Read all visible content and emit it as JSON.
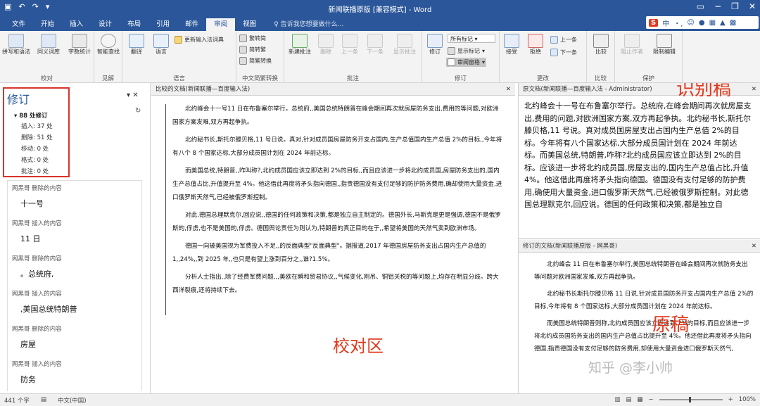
{
  "window": {
    "title": "新闻联播原版 [兼容模式] - Word"
  },
  "tabs": [
    "文件",
    "开始",
    "插入",
    "设计",
    "布局",
    "引用",
    "邮件",
    "审阅",
    "视图"
  ],
  "active_tab": "审阅",
  "tellme": "告诉我您想要做什么...",
  "ime": {
    "label": "中"
  },
  "ribbon": {
    "proofing": {
      "label": "校对",
      "buttons": [
        "拼写和语法",
        "同义词库",
        "字数统计"
      ]
    },
    "insights": {
      "label": "见解",
      "buttons": [
        "智能查找"
      ]
    },
    "language": {
      "label": "语言",
      "buttons": [
        "翻译",
        "语言"
      ],
      "extra": "更新输入法词典"
    },
    "chinese": {
      "label": "中文简繁转换",
      "buttons": [
        "繁转简",
        "简转繁",
        "简繁转换"
      ]
    },
    "comments": {
      "label": "批注",
      "buttons": [
        "新建批注",
        "删除",
        "上一条",
        "下一条",
        "显示批注"
      ]
    },
    "tracking": {
      "label": "修订",
      "buttons": [
        "修订"
      ],
      "markup_select": "所有标记",
      "show_markup": "显示标记",
      "pane": "审阅窗格"
    },
    "changes": {
      "label": "更改",
      "buttons": [
        "接受",
        "拒绝"
      ],
      "prev": "上一条",
      "next": "下一条"
    },
    "compare": {
      "label": "比较",
      "buttons": [
        "比较"
      ]
    },
    "protect": {
      "label": "保护",
      "buttons": [
        "阻止作者",
        "限制编辑"
      ]
    }
  },
  "revisions_pane": {
    "title": "修订",
    "count": "88 处修订",
    "lines": [
      "插入: 37 处",
      "删除: 51 处",
      "移动: 0 处",
      "格式: 0 处",
      "批注: 0 处"
    ],
    "items": [
      {
        "who": "网黑哥 删除的内容",
        "what": "十一号"
      },
      {
        "who": "网黑哥 插入的内容",
        "what": "11 日"
      },
      {
        "who": "网黑哥 删除的内容",
        "what": "。总统府,"
      },
      {
        "who": "网黑哥 插入的内容",
        "what": ",美国总统特朗普"
      },
      {
        "who": "网黑哥 删除的内容",
        "what": "房屋"
      },
      {
        "who": "网黑哥 插入的内容",
        "what": "防务"
      }
    ]
  },
  "compare_pane": {
    "header": "比较的文档(新闻联播—百度输入法)",
    "paragraphs": [
      "北约峰会十一号11 日在布鲁塞尔举行。总统府,,美国总统特朗普在峰会期间再次就房屋防务支出,费用的等问题,对欧洲国家方案发难,双方再起争执。",
      "北约秘书长,斯托尔滕贝格,11 号日说。真对,针对成员国房屋防务开支占国内,生产总值国内生产总值 2%的目标,,今年将有八个 8 个国家达标,大部分成员国计划在 2024 年前达标。",
      "而美国总统,特朗普,,咋叫称?,北约成员国应该立即达到 2%的目标,,而且应该进一步将北约成员国,房屋防务支出的,国内生产总值占比,升值提升至 4%。他这借此再度将矛头指向德国,,指责德国没有支付足够的防护防务费用,确却使用大量资金,进口俄罗斯天然气,已经被俄罗斯控制。",
      "对此,德国总理默克尔,回应说,,德国的任何政策和决策,都是独立自主制定的。德国外长,马斯克是更是强调,德国不是俄罗斯的,俘虏,也不是美国的,俘虏。德国舆论责任为则认为,特朗普的真正目的在于,,希望将美国的天然气卖到欧洲市场。",
      "德国一向被美国视为军费投入不足,,的反面典型\"反面典型\"。据报道,2017 年德国房屋防务支出占国内生产总值的 1,,24%,,到 2025 年,,也只是有望上涨到百分之,,谁?1.5%。",
      "分析人士指出,,除了经费军费问题,,,美欧在瞬和贸易协议,,气候变化,刚吊、铜铝关税的等问题上,均存在明显分歧。跨大西洋裂痕,还将持续下去。"
    ]
  },
  "original_pane": {
    "header": "原文档(新闻联播—百度输入法 - Administrator)",
    "text": "北约峰会十一号在布鲁塞尔举行。总统府,在峰会期间再次就房屋支出,费用的问题,对欧洲国家方案,双方再起争执。北约秘书长,斯托尔滕贝格,11 号说。真对成员国房屋支出占国内生产总值 2%的目标。今年将有八个国家达标,大部分成员国计划在 2024 年前达标。而美国总统,特朗普,咋称?北约成员国应该立即达到 2%的目标。应该进一步将北约成员国,房屋支出的,国内生产总值占比,升值 4%。他这借此再度将矛头指向德国。德国没有支付足够的防护费用,确使用大量资金,进口俄罗斯天然气,已经被俄罗斯控制。对此德国总理默克尔,回应说。德国的任何政策和决策,都是独立自"
  },
  "revised_pane": {
    "header": "修订的文档(新闻联播原版 - 网黑哥)",
    "paragraphs": [
      "北约峰会 11 日在布鲁塞尔举行,美国总统特朗普在峰会期间再次就防务支出等问题对欧洲国家发难,双方再起争执。",
      "北约秘书长斯托尔滕贝格 11 日说,针对成员国防务开支占国内生产总值 2%的目标,今年将有 8 个国家达标,大部分成员国计划在 2024 年前达标。",
      "而美国总统特朗普则称,北约成员国应该立即达到 2%的目标,而且应该进一步将北约成员国防务支出的国内生产总值占比提升至 4%。他还借此再度将矛头指向德国,指责德国没有支付足够的防务费用,却使用大量资金进口俄罗斯天然气,"
    ]
  },
  "annotations": {
    "recognized": "识别稿",
    "proof_area": "校对区",
    "original": "原稿"
  },
  "watermark": "知乎 @李小帅",
  "status": {
    "words": "441 个字",
    "lang": "中文(中国)",
    "zoom": "100%"
  },
  "colors": {
    "brand": "#2b579a",
    "revision": "#c0392b",
    "annotation": "#e03a1e"
  }
}
